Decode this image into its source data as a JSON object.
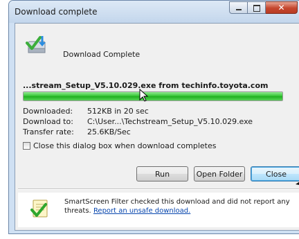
{
  "window": {
    "title": "Download complete"
  },
  "header": {
    "text": "Download Complete"
  },
  "download": {
    "filename_line": "...stream_Setup_V5.10.029.exe from techinfo.toyota.com",
    "progress_percent": 100,
    "downloaded_label": "Downloaded:",
    "downloaded_value": "512KB in 20 sec",
    "download_to_label": "Download to:",
    "download_to_value": "C:\\User...\\Techstream_Setup_V5.10.029.exe",
    "transfer_rate_label": "Transfer rate:",
    "transfer_rate_value": "25.6KB/Sec"
  },
  "options": {
    "close_checkbox_label": "Close this dialog box when download completes",
    "close_checkbox_checked": false
  },
  "buttons": {
    "run": "Run",
    "open_folder": "Open Folder",
    "close": "Close"
  },
  "footer": {
    "text": "SmartScreen Filter checked this download and did not report any threats.",
    "link": "Report an unsafe download."
  },
  "colors": {
    "progress_green": "#2fc12f",
    "close_button_blue": "#3c7fb1",
    "link_blue": "#0645ad"
  }
}
